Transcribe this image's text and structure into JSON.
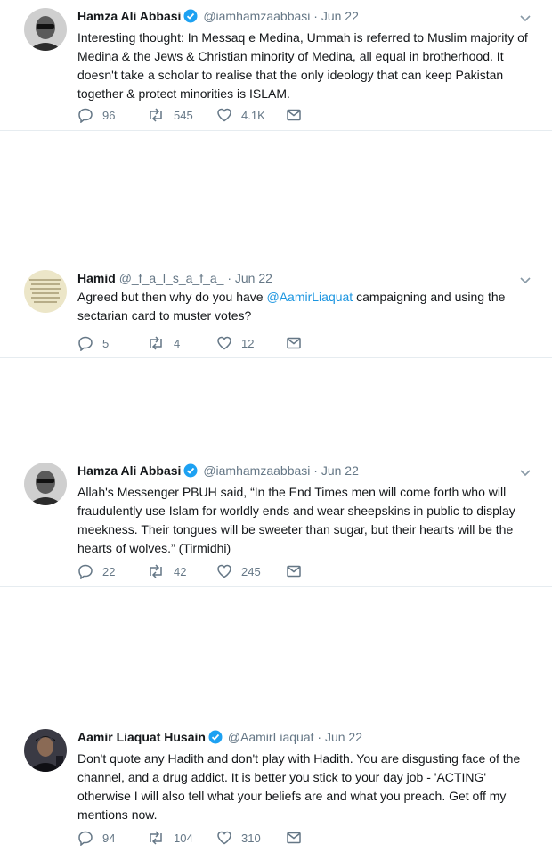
{
  "tweets": [
    {
      "name": "Hamza Ali Abbasi",
      "handle": "@iamhamzaabbasi",
      "separator": "·",
      "time": "Jun 22",
      "verified": true,
      "text": "Interesting thought: In Messaq e Medina, Ummah is referred to Muslim majority of Medina & the Jews & Christian minority of Medina, all equal in brotherhood. It doesn't take a scholar to realise that the only ideology that can keep Pakistan together & protect minorities is ISLAM.",
      "replies": "96",
      "retweets": "545",
      "likes": "4.1K"
    },
    {
      "name": "Hamid",
      "handle": "@_f_a_l_s_a_f_a_",
      "separator": "·",
      "time": "Jun 22",
      "verified": false,
      "text_before": "Agreed but then why do you have ",
      "mention": "@AamirLiaquat",
      "text_after": " campaigning and using the sectarian card to muster votes?",
      "replies": "5",
      "retweets": "4",
      "likes": "12"
    },
    {
      "name": "Hamza Ali Abbasi",
      "handle": "@iamhamzaabbasi",
      "separator": "·",
      "time": "Jun 22",
      "verified": true,
      "text": "Allah's Messenger PBUH said, “In the End Times men will come forth who will fraudulently use Islam for worldly ends and wear sheepskins in public to display meekness. Their tongues will be sweeter than sugar, but their hearts will be the hearts of wolves.” (Tirmidhi)",
      "replies": "22",
      "retweets": "42",
      "likes": "245"
    },
    {
      "name": "Aamir Liaquat Husain",
      "handle": "@AamirLiaquat",
      "separator": "·",
      "time": "Jun 22",
      "verified": true,
      "text": "Don't quote any Hadith and don't play with Hadith. You are disgusting face of the channel, and a drug addict. It is better you stick to your day job - 'ACTING' otherwise I will also tell what your beliefs are and what you preach. Get off my mentions now.",
      "replies": "94",
      "retweets": "104",
      "likes": "310"
    }
  ],
  "colors": {
    "text": "#14171a",
    "secondary": "#657786",
    "link": "#1b95e0",
    "verified": "#1da1f2",
    "divider": "#e6ecf0"
  },
  "icons": [
    "reply-icon",
    "retweet-icon",
    "like-icon",
    "direct-message-icon",
    "chevron-down-icon",
    "verified-badge-icon"
  ]
}
